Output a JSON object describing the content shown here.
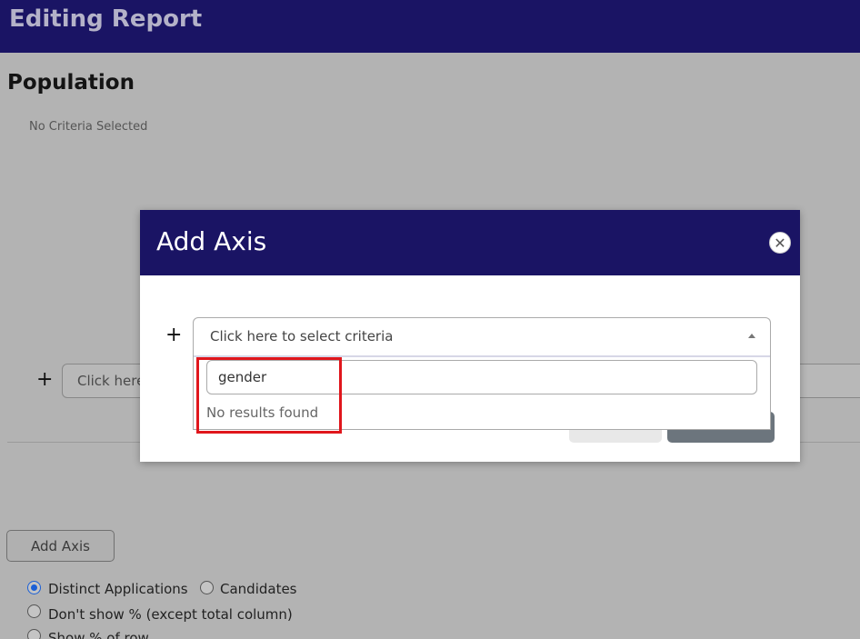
{
  "header": {
    "title": "Editing Report"
  },
  "population": {
    "title": "Population",
    "empty_text": "No Criteria Selected"
  },
  "background_select": {
    "placeholder": "Click here"
  },
  "add_axis_button": "Add Axis",
  "options": {
    "distinct_applications": "Distinct Applications",
    "candidates": "Candidates",
    "dont_show_pct": "Don't show % (except total column)",
    "show_pct_row": "Show % of row"
  },
  "modal": {
    "title": "Add Axis",
    "close_icon": "close-icon",
    "plus_icon": "plus-icon",
    "select_placeholder": "Click here to select criteria",
    "search_value": "gender",
    "no_results": "No results found"
  },
  "colors": {
    "header_bg": "#1a1464",
    "highlight": "#e0161c",
    "radio_checked": "#1a5fd6"
  }
}
